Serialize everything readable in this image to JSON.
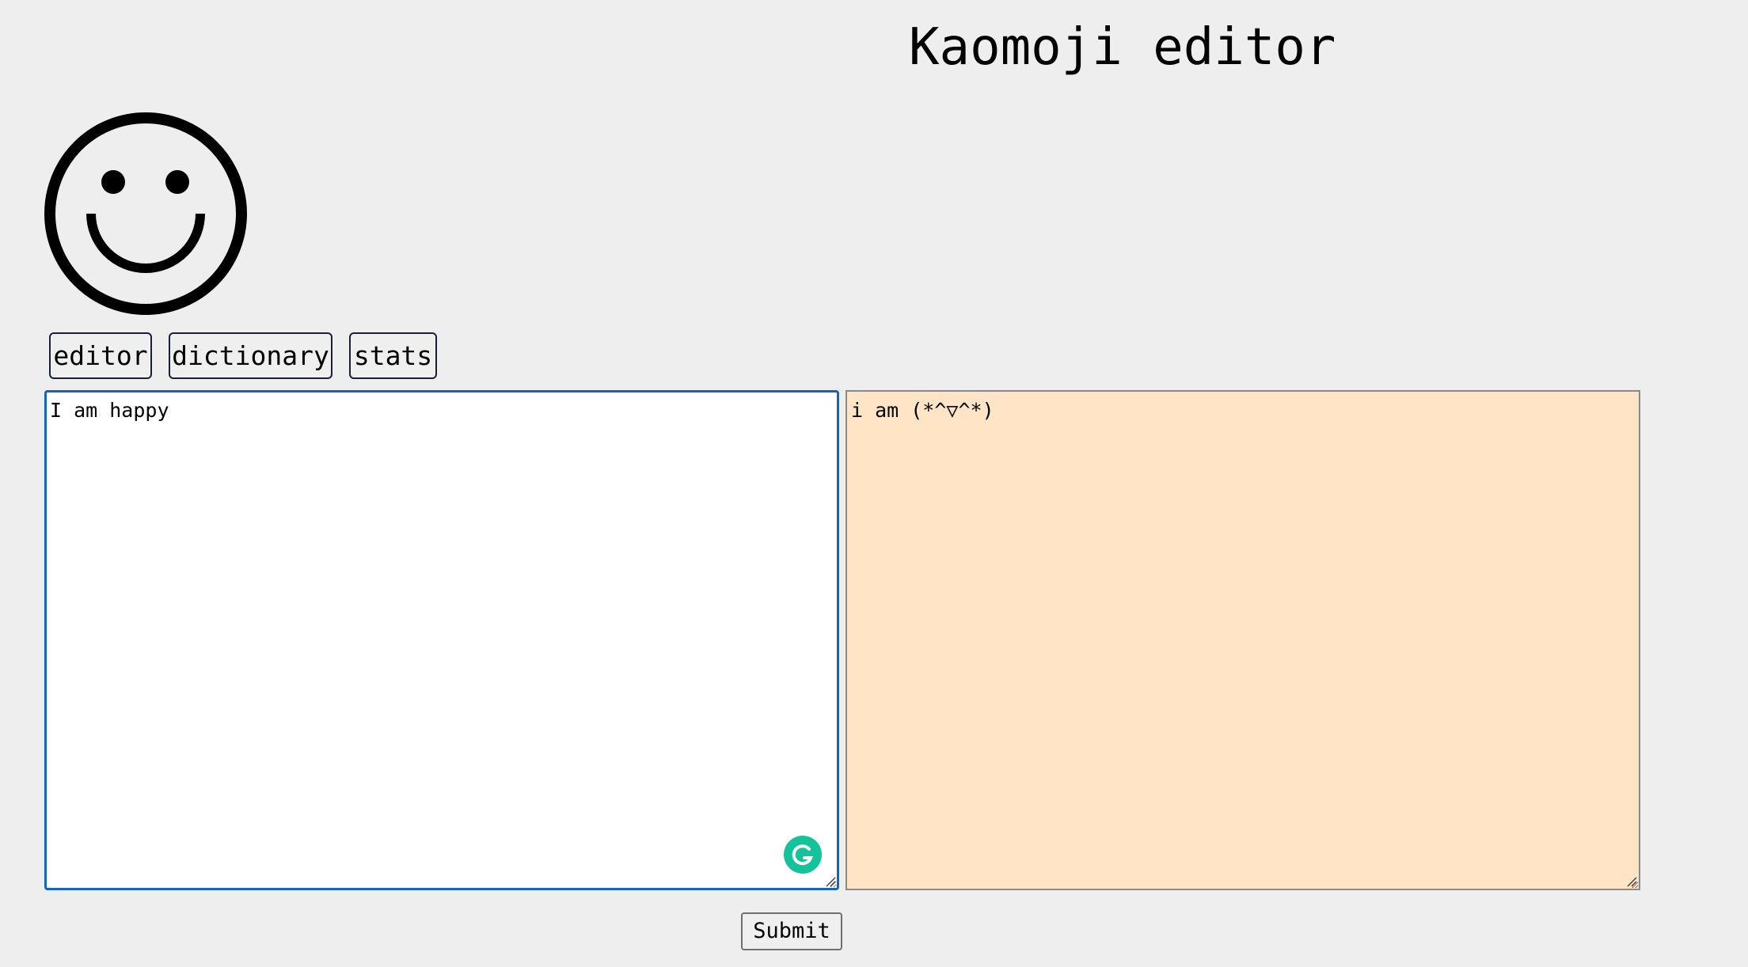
{
  "page": {
    "title": "Kaomoji editor"
  },
  "logo": {
    "icon": "smiley-face-icon"
  },
  "nav": {
    "editor_label": "editor",
    "dictionary_label": "dictionary",
    "stats_label": "stats"
  },
  "editor": {
    "input_value": "I am happy",
    "output_value": "i am (*^▽^*)"
  },
  "actions": {
    "submit_label": "Submit"
  },
  "colors": {
    "background": "#eeeeee",
    "input_focus_border": "#1565c0",
    "output_background": "#ffe4c6",
    "grammarly_badge": "#15c39a"
  }
}
